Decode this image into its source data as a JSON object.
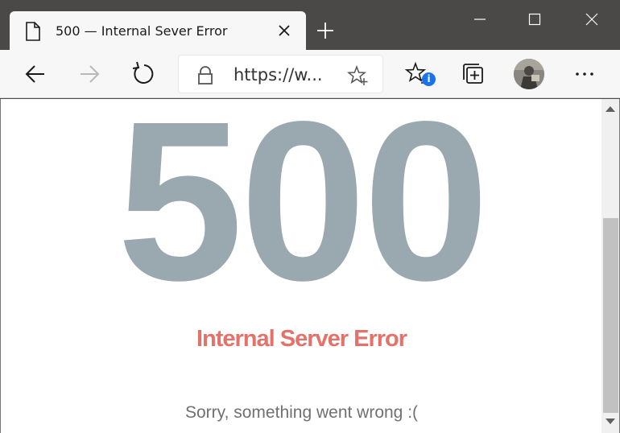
{
  "tab": {
    "title": "500 — Internal Sever Error"
  },
  "address": {
    "url": "https://w..."
  },
  "toolbar": {
    "collections_badge": "i"
  },
  "page": {
    "code": "500",
    "title": "Internal Server Error",
    "message": "Sorry, something went wrong :("
  },
  "colors": {
    "code": "#9aa8b0",
    "title": "#e3736a",
    "message": "#707070",
    "frame": "#4a4948",
    "toolbar": "#f7f7f7"
  },
  "icons": {
    "tab": "page-icon",
    "close": "close-icon",
    "new_tab": "plus-icon",
    "back": "back-arrow-icon",
    "forward": "forward-arrow-icon",
    "refresh": "refresh-icon",
    "lock": "lock-icon",
    "favorite": "star-icon",
    "favorites": "favorites-icon",
    "collections": "collections-icon",
    "profile": "avatar",
    "more": "more-icon"
  }
}
